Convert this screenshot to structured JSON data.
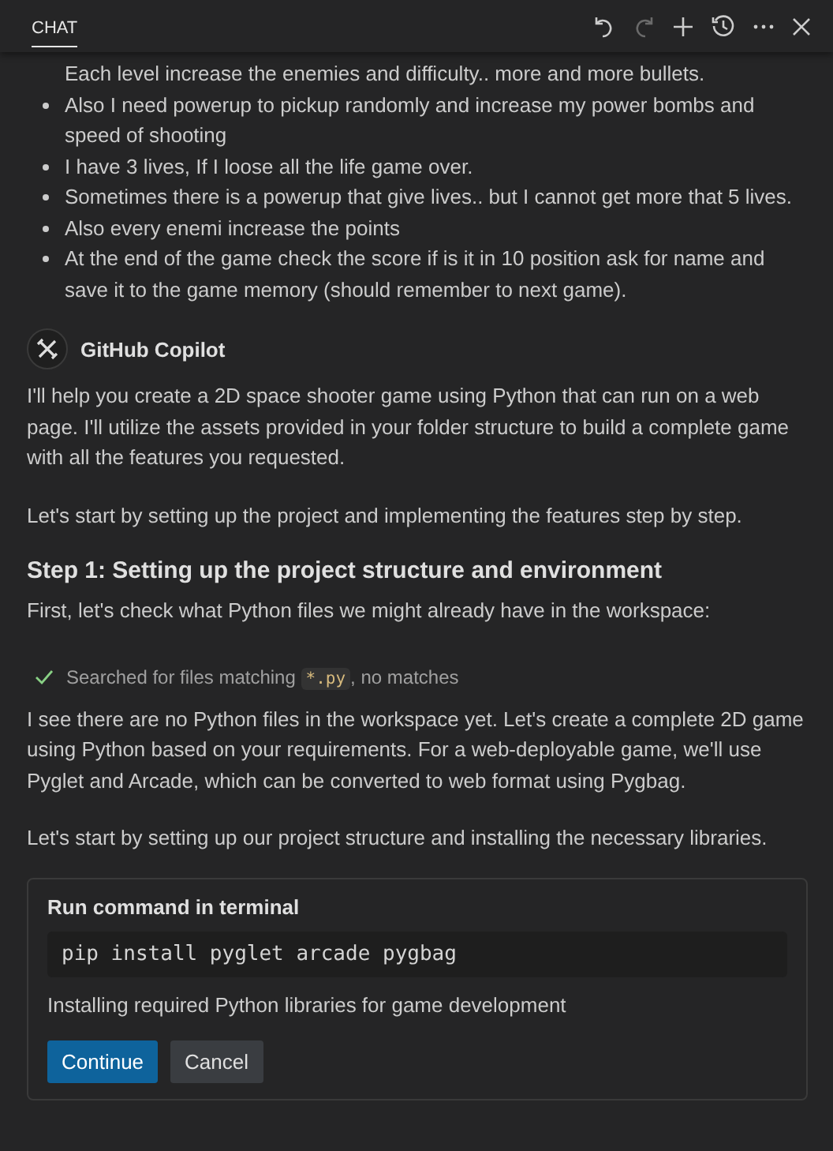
{
  "header": {
    "tab": {
      "label": "CHAT",
      "selected": true
    },
    "actions": [
      {
        "kind": "undo",
        "disabled": false
      },
      {
        "kind": "redo",
        "disabled": true
      },
      {
        "kind": "new",
        "disabled": false
      },
      {
        "kind": "history",
        "disabled": false
      },
      {
        "kind": "more",
        "disabled": false
      },
      {
        "kind": "close",
        "disabled": false
      }
    ]
  },
  "user_message": {
    "items": [
      {
        "kind": "continuation",
        "text": "Each level increase the enemies and difficulty.. more and more bullets."
      },
      {
        "kind": "bullet",
        "text": "Also I need powerup to pickup randomly and increase my power bombs and speed of shooting"
      },
      {
        "kind": "bullet",
        "text": "I have 3 lives, If I loose all the life game over."
      },
      {
        "kind": "bullet",
        "text": "Sometimes there is a powerup that give lives.. but I cannot get more that 5 lives."
      },
      {
        "kind": "bullet",
        "text": "Also every enemi increase the points"
      },
      {
        "kind": "bullet",
        "text": "At the end of the game check the score if is it in 10 position ask for name and save it to the game memory (should remember to next game)."
      }
    ]
  },
  "response": {
    "author": "GitHub Copilot",
    "blocks": [
      {
        "kind": "paragraph",
        "text": "I'll help you create a 2D space shooter game using Python that can run on a web page. I'll utilize the assets provided in your folder structure to build a complete game with all the features you requested."
      },
      {
        "kind": "paragraph",
        "text": "Let's start by setting up the project and implementing the features step by step."
      },
      {
        "kind": "heading",
        "text": "Step 1: Setting up the project structure and environment"
      },
      {
        "kind": "paragraph",
        "text": "First, let's check what Python files we might already have in the workspace:"
      },
      {
        "kind": "tool",
        "text": "Searched for files matching",
        "code": "*.py",
        "suffix": ", no matches",
        "done": true
      },
      {
        "kind": "paragraph",
        "text": "I see there are no Python files in the workspace yet. Let's create a complete 2D game using Python based on your requirements. For a web-deployable game, we'll use Pyglet and Arcade, which can be converted to web format using Pygbag."
      },
      {
        "kind": "paragraph",
        "text": "Let's start by setting up our project structure and installing the necessary libraries."
      }
    ],
    "terminal": {
      "title": "Run command in terminal",
      "command": "pip install pyglet arcade pygbag",
      "description": "Installing required Python libraries for game development",
      "buttons": [
        {
          "label": "Continue",
          "primary": true
        },
        {
          "label": "Cancel",
          "primary": false
        }
      ]
    }
  }
}
